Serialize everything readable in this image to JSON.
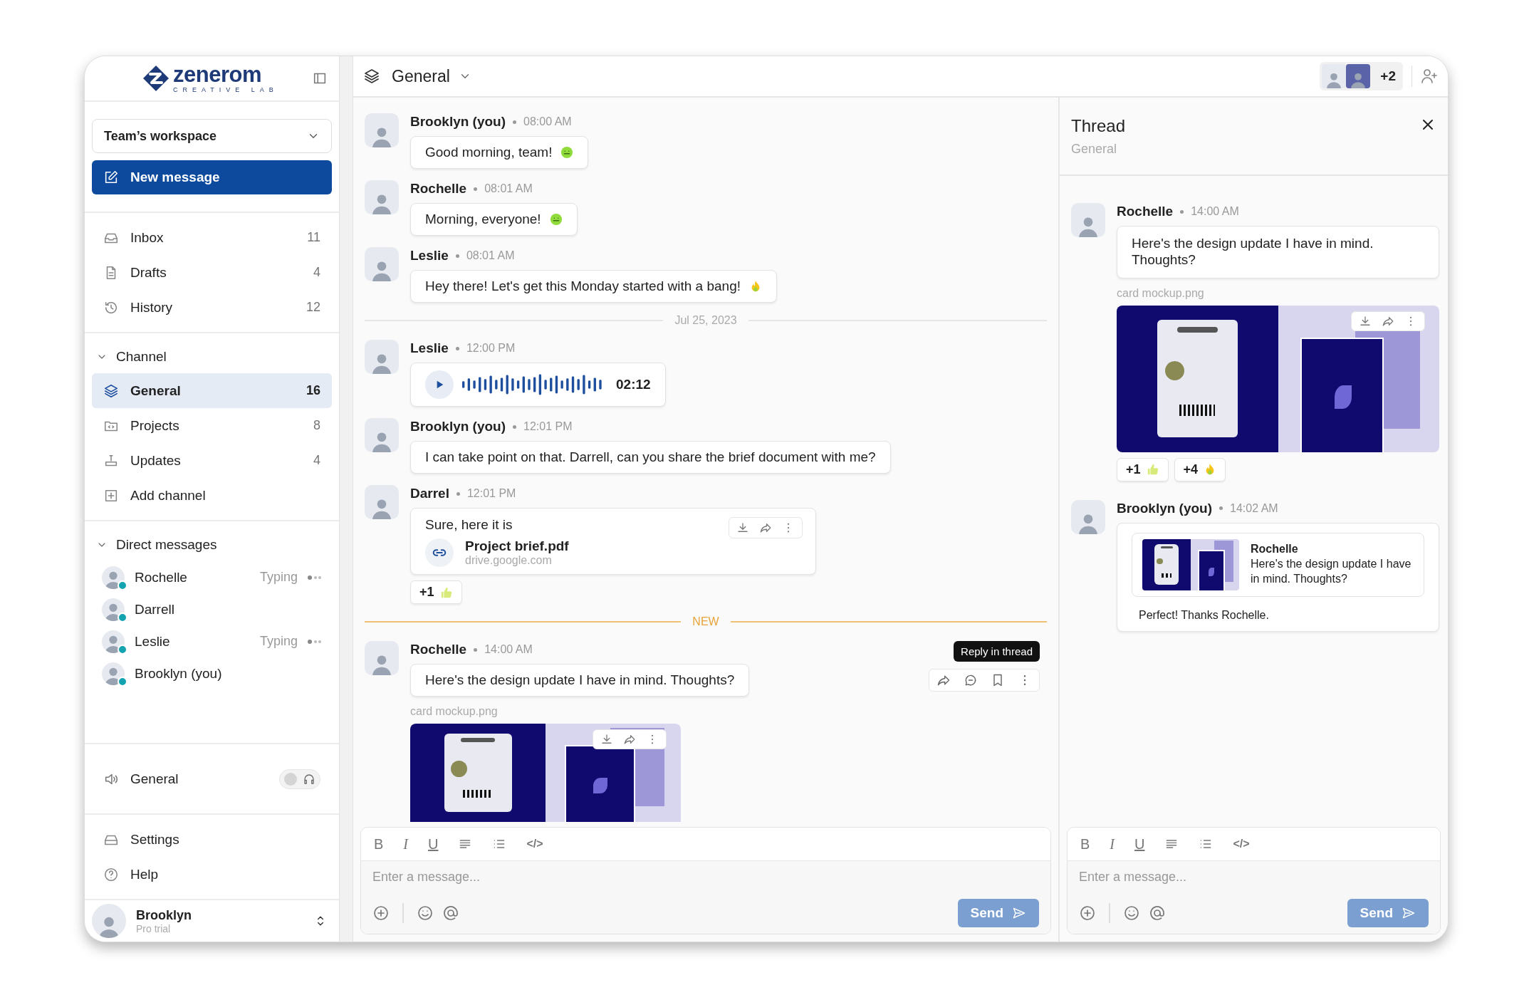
{
  "sidebar": {
    "logo": {
      "name": "zenerom",
      "tagline": "CREATIVE LAB"
    },
    "workspace": "Team’s workspace",
    "new_message": "New message",
    "nav": [
      {
        "label": "Inbox",
        "count": "11",
        "kind": "inbox"
      },
      {
        "label": "Drafts",
        "count": "4",
        "kind": "drafts"
      },
      {
        "label": "History",
        "count": "12",
        "kind": "history"
      }
    ],
    "channels": {
      "title": "Channel",
      "expanded": true,
      "items": [
        {
          "label": "General",
          "count": "16",
          "selected": true,
          "kind": "layers"
        },
        {
          "label": "Projects",
          "count": "8",
          "selected": false,
          "kind": "folder"
        },
        {
          "label": "Updates",
          "count": "4",
          "selected": false,
          "kind": "updates"
        }
      ],
      "add_label": "Add channel"
    },
    "direct_messages": {
      "title": "Direct messages",
      "expanded": true,
      "items": [
        {
          "name": "Rochelle",
          "status": "Typing",
          "online": true
        },
        {
          "name": "Darrell",
          "online": true
        },
        {
          "name": "Leslie",
          "status": "Typing",
          "online": true
        },
        {
          "name": "Brooklyn (you)",
          "online": true
        }
      ]
    },
    "voice": {
      "label": "General",
      "on": false
    },
    "footer": [
      {
        "label": "Settings",
        "kind": "settings"
      },
      {
        "label": "Help",
        "kind": "help"
      }
    ],
    "user": {
      "name": "Brooklyn",
      "plan": "Pro trial"
    }
  },
  "header": {
    "channel": "General",
    "more_members": "+2"
  },
  "messages": [
    {
      "kind": "text",
      "author": "Brooklyn (you)",
      "time": "08:00 AM",
      "text": "Good morning, team!",
      "emoji": {
        "kind": "smile"
      }
    },
    {
      "kind": "text",
      "author": "Rochelle",
      "time": "08:01 AM",
      "text": "Morning, everyone!",
      "emoji": {
        "kind": "smile"
      }
    },
    {
      "kind": "text",
      "author": "Leslie",
      "time": "08:01 AM",
      "text": "Hey there! Let's get this Monday started with a bang!",
      "emoji": {
        "kind": "fire"
      }
    },
    {
      "kind": "date",
      "label": "Jul 25, 2023"
    },
    {
      "kind": "audio",
      "author": "Leslie",
      "time": "12:00 PM",
      "duration": "02:12"
    },
    {
      "kind": "text",
      "author": "Brooklyn (you)",
      "time": "12:01 PM",
      "text": "I can take point on that. Darrell, can you share the brief document with me?"
    },
    {
      "kind": "file",
      "author": "Darrel",
      "time": "12:01 PM",
      "text": "Sure, here it is",
      "file": "Project brief.pdf",
      "source": "drive.google.com",
      "actions": true,
      "reactions": [
        {
          "count": "+1",
          "kind": "thumbs"
        }
      ]
    },
    {
      "kind": "new",
      "label": "NEW"
    },
    {
      "kind": "image",
      "author": "Rochelle",
      "time": "14:00 AM",
      "text": "Here's the design update I have in mind. Thoughts?",
      "file": "card mockup.png",
      "actions": true,
      "tooltip": "Reply in thread"
    }
  ],
  "composer": {
    "placeholder": "Enter a message...",
    "send": "Send",
    "tools": [
      {
        "kind": "bold",
        "glyph": "B"
      },
      {
        "kind": "italic",
        "glyph": "I"
      },
      {
        "kind": "underline",
        "glyph": "U"
      },
      {
        "kind": "align"
      },
      {
        "kind": "list"
      },
      {
        "kind": "code",
        "glyph": "</>"
      }
    ]
  },
  "thread": {
    "title": "Thread",
    "channel": "General",
    "messages": [
      {
        "kind": "image",
        "author": "Rochelle",
        "time": "14:00 AM",
        "text": "Here's the design update I have in mind. Thoughts?",
        "file": "card mockup.png",
        "actions": true,
        "reactions": [
          {
            "count": "+1",
            "kind": "thumbs"
          },
          {
            "count": "+4",
            "kind": "fire"
          }
        ]
      },
      {
        "kind": "reply",
        "author": "Brooklyn (you)",
        "time": "14:02 AM",
        "quote": {
          "author": "Rochelle",
          "text": "Here's the design update I have in mind. Thoughts?"
        },
        "text": "Perfect! Thanks Rochelle."
      }
    ],
    "composer": {
      "placeholder": "Enter a message...",
      "send": "Send",
      "tools": [
        {
          "kind": "bold",
          "glyph": "B"
        },
        {
          "kind": "italic",
          "glyph": "I"
        },
        {
          "kind": "underline",
          "glyph": "U"
        },
        {
          "kind": "align"
        },
        {
          "kind": "list"
        },
        {
          "kind": "code",
          "glyph": "</>"
        }
      ]
    }
  }
}
